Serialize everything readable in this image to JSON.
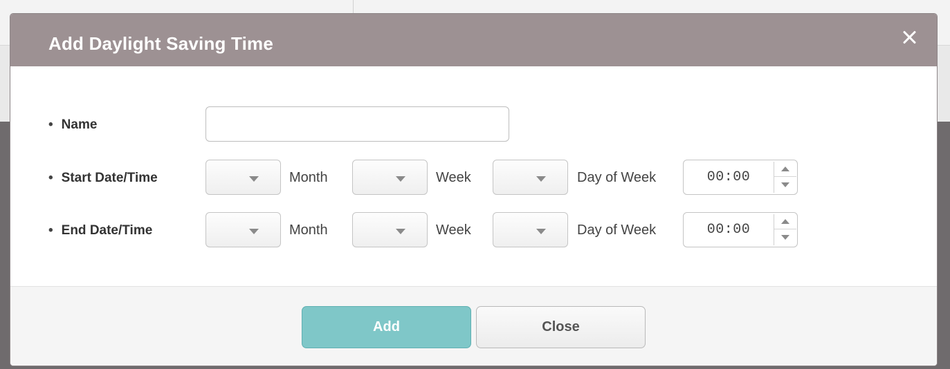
{
  "dialog": {
    "title": "Add Daylight Saving Time"
  },
  "form": {
    "name": {
      "label": "Name",
      "value": "",
      "placeholder": ""
    },
    "start": {
      "label": "Start Date/Time",
      "month_value": "",
      "month_unit": "Month",
      "week_value": "",
      "week_unit": "Week",
      "day_value": "",
      "day_unit": "Day of Week",
      "time": "00:00"
    },
    "end": {
      "label": "End Date/Time",
      "month_value": "",
      "month_unit": "Month",
      "week_value": "",
      "week_unit": "Week",
      "day_value": "",
      "day_unit": "Day of Week",
      "time": "00:00"
    },
    "bullet": "•"
  },
  "footer": {
    "add_label": "Add",
    "close_label": "Close"
  },
  "colors": {
    "header_bg": "#9d9193",
    "add_button": "#7fc7c8",
    "overlay": "#6f6b6d"
  },
  "icons": {
    "close": "close-icon",
    "dropdown": "chevron-down-icon",
    "spin_up": "arrow-up-icon",
    "spin_down": "arrow-down-icon"
  }
}
